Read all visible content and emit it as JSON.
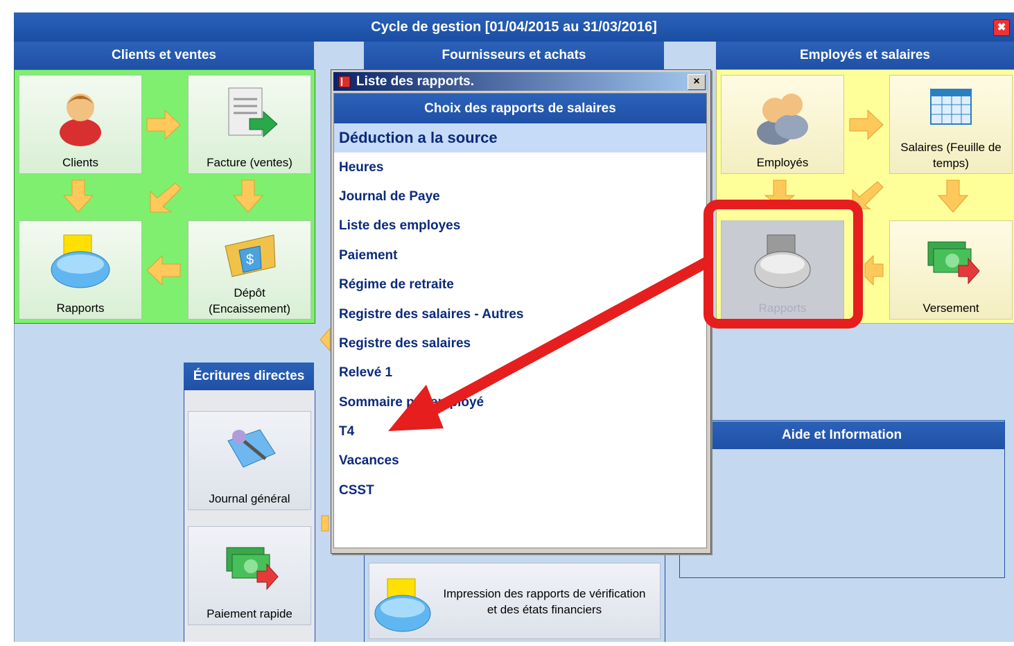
{
  "window": {
    "title": "Cycle de gestion [01/04/2015 au 31/03/2016]",
    "close_glyph": "✖"
  },
  "sections": {
    "clients": "Clients et ventes",
    "fournisseurs": "Fournisseurs et achats",
    "employes": "Employés et salaires",
    "ecritures": "Écritures directes",
    "aide": "Aide et Information"
  },
  "clients_tiles": {
    "clients": "Clients",
    "facture": "Facture (ventes)",
    "rapports": "Rapports",
    "depot_1": "Dépôt",
    "depot_2": "(Encaissement)"
  },
  "employes_tiles": {
    "employes": "Employés",
    "salaires_1": "Salaires (Feuille de",
    "salaires_2": "temps)",
    "rapports": "Rapports",
    "versement": "Versement"
  },
  "ecritures_tiles": {
    "journal": "Journal général",
    "paiement": "Paiement rapide"
  },
  "fournisseurs_tiles": {
    "impression_1": "Impression des rapports de vérification",
    "impression_2": "et des états financiers"
  },
  "dialog": {
    "title": "Liste des rapports.",
    "close_glyph": "×",
    "header": "Choix des rapports de salaires",
    "items": [
      "Déduction a la source",
      "Heures",
      "Journal de Paye",
      "Liste des employes",
      "Paiement",
      "Régime de retraite",
      "Registre des salaires - Autres",
      "Registre des salaires",
      "Relevé 1",
      "Sommaire par employé",
      "T4",
      "Vacances",
      "CSST"
    ],
    "selected_index": 0
  },
  "colors": {
    "accent": "#1f50a6",
    "green_panel": "#7fef6f",
    "yellow_panel": "#ffff99",
    "annotation": "#e61e1e"
  }
}
